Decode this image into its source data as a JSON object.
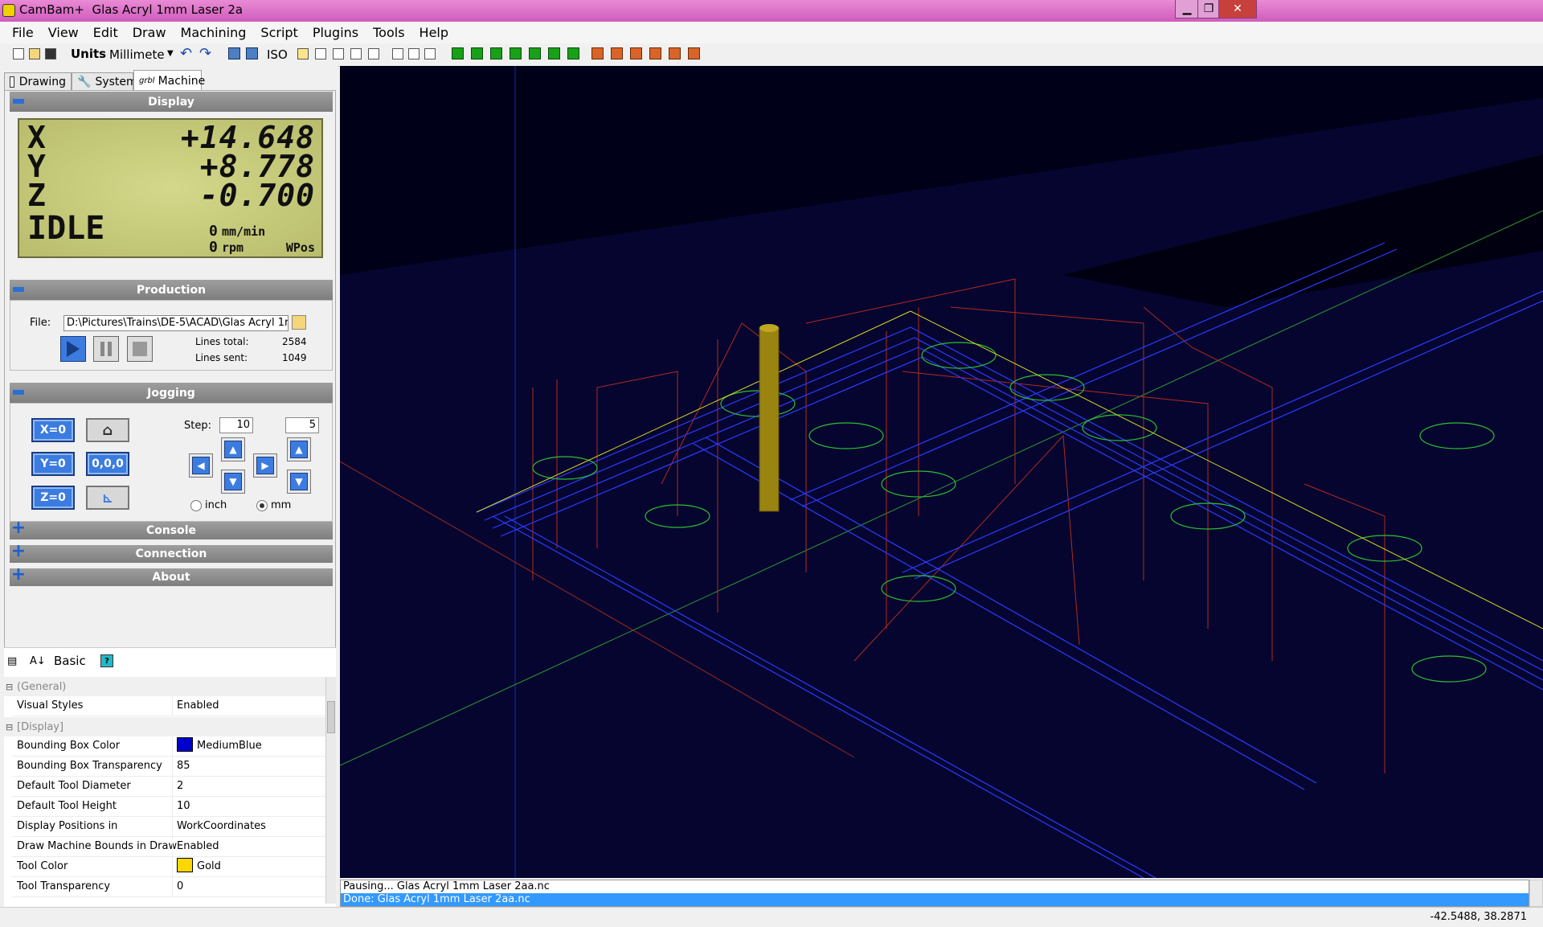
{
  "window": {
    "title": "CamBam+  Glas Acryl 1mm Laser 2a",
    "controls": [
      "minimize-icon",
      "maximize-icon",
      "close-icon"
    ]
  },
  "menu": [
    "File",
    "View",
    "Edit",
    "Draw",
    "Machining",
    "Script",
    "Plugins",
    "Tools",
    "Help"
  ],
  "toolbar": {
    "units_label": "Units",
    "units_value": "Millimete",
    "iso_label": "ISO"
  },
  "tabs": [
    {
      "label": "Drawing",
      "icon": "page-icon"
    },
    {
      "label": "System",
      "icon": "wrench-icon"
    },
    {
      "label": "Machine",
      "icon": "grbl-icon",
      "active": true
    }
  ],
  "grbl_icon_text": "grbl",
  "display": {
    "header": "Display",
    "x_label": "X",
    "x_value": "+14.648",
    "y_label": "Y",
    "y_value": "+8.778",
    "z_label": "Z",
    "z_value": "-0.700",
    "state": "IDLE",
    "feed_value": "0",
    "feed_unit": "mm/min",
    "speed_value": "0",
    "speed_unit": "rpm",
    "coord_mode": "WPos"
  },
  "production": {
    "header": "Production",
    "file_label": "File:",
    "file_path": "D:\\Pictures\\Trains\\DE-5\\ACAD\\Glas Acryl 1r",
    "lines_total_label": "Lines total:",
    "lines_total": "2584",
    "lines_sent_label": "Lines sent:",
    "lines_sent": "1049"
  },
  "jogging": {
    "header": "Jogging",
    "x_zero": "X=0",
    "y_zero": "Y=0",
    "z_zero": "Z=0",
    "origin": "0,0,0",
    "step_label": "Step:",
    "step_xy": "10",
    "step_z": "5",
    "unit_inch": "inch",
    "unit_mm": "mm",
    "selected_unit": "mm",
    "arrow_y_plus": "Y+",
    "arrow_y_minus": "Y-",
    "arrow_x_plus": "X+",
    "arrow_x_minus": "X-",
    "arrow_z_plus": "Z+",
    "arrow_z_minus": "Z-"
  },
  "collapsed_sections": [
    "Console",
    "Connection",
    "About"
  ],
  "properties": {
    "basic_label": "Basic",
    "categories": [
      {
        "name": "(General)",
        "rows": [
          {
            "key": "Visual Styles",
            "value": "Enabled"
          }
        ]
      },
      {
        "name": "[Display]",
        "rows": [
          {
            "key": "Bounding Box Color",
            "value": "MediumBlue",
            "swatch": "#0000cd"
          },
          {
            "key": "Bounding Box Transparency",
            "value": "85"
          },
          {
            "key": "Default Tool Diameter",
            "value": "2"
          },
          {
            "key": "Default Tool Height",
            "value": "10"
          },
          {
            "key": "Display Positions in",
            "value": "WorkCoordinates"
          },
          {
            "key": "Draw Machine Bounds in Drawing",
            "value": "Enabled"
          },
          {
            "key": "Tool Color",
            "value": "Gold",
            "swatch": "#ffd700"
          },
          {
            "key": "Tool Transparency",
            "value": "0"
          }
        ]
      }
    ]
  },
  "log": [
    "Pausing... Glas Acryl 1mm Laser 2aa.nc",
    "Done: Glas Acryl 1mm Laser 2aa.nc"
  ],
  "status": {
    "coords": "-42.5488, 38.2871"
  },
  "colors": {
    "titlebar": "#d96cc6",
    "accent": "#3c7ce0",
    "viewport_bg": "#000018",
    "toolpath_green": "#2fbf2f",
    "toolpath_blue": "#2a3cff",
    "rapid_red": "#b42a1a",
    "tool_gold": "#a08a10",
    "selection": "#3399ff"
  }
}
